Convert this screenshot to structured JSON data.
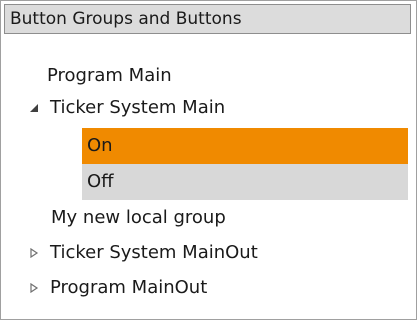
{
  "header": {
    "title": "Button Groups and Buttons"
  },
  "tree": {
    "items": [
      {
        "label": "Program Main",
        "expander": "none"
      },
      {
        "label": "Ticker System Main",
        "expander": "expanded-triangle-icon"
      },
      {
        "label": "On",
        "state": "selected"
      },
      {
        "label": "Off",
        "state": "normal"
      },
      {
        "label": "My new local group",
        "expander": "none"
      },
      {
        "label": "Ticker System MainOut",
        "expander": "collapsed-triangle-icon"
      },
      {
        "label": "Program MainOut",
        "expander": "collapsed-triangle-icon"
      }
    ]
  },
  "colors": {
    "selected": "#f08a00",
    "unselected_button": "#d8d8d8",
    "header_bg": "#dcdcdc"
  }
}
